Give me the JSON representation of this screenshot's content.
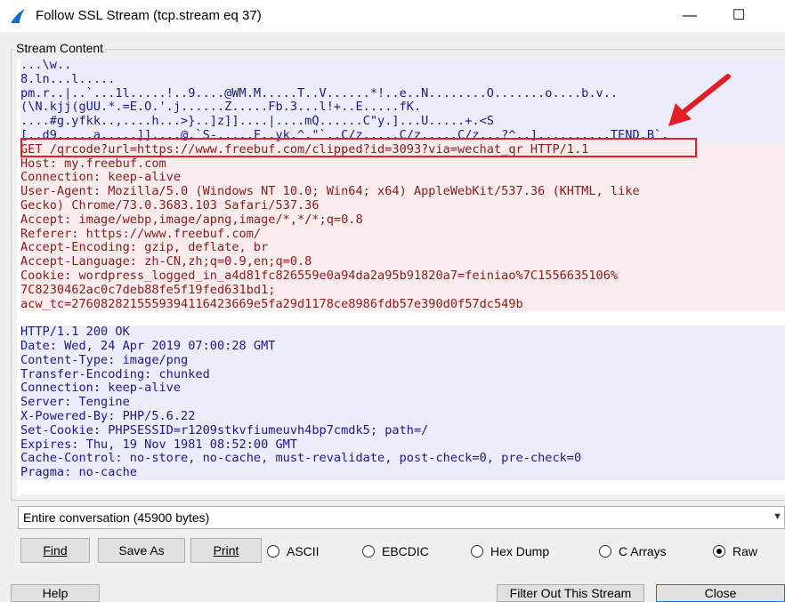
{
  "window": {
    "title": "Follow SSL Stream (tcp.stream eq 37)",
    "minimize_glyph": "—",
    "maximize_glyph": "☐"
  },
  "group": {
    "label": "Stream Content"
  },
  "stream_lines": [
    {
      "text": "...\\w..",
      "kind": "srv"
    },
    {
      "text": "8.ln...l.....",
      "kind": "srv"
    },
    {
      "text": "pm.r..|..`...1l.....!..9....@WM.M.....T..V......*!..e..N........O.......o....b.v..",
      "kind": "srv"
    },
    {
      "text": "(\\N.kjj(gUU.*.=E.O.'.j......Z.....Fb.3...l!+..E.....fK.",
      "kind": "srv"
    },
    {
      "text": "....#g.yfkk..,....h...>}..]z]]....|....mQ......C\"y.]...U.....+.<S",
      "kind": "srv"
    },
    {
      "text": "[..d9.....a.....]]....@.`S-.....F..yk.^.\"`..C/z.....C/z.....C/z...?^..]..........TEND.B`.",
      "kind": "srv"
    },
    {
      "text": "GET /qrcode?url=https://www.freebuf.com/clipped?id=3093?via=wechat_qr HTTP/1.1",
      "kind": "cli"
    },
    {
      "text": "Host: my.freebuf.com",
      "kind": "cli"
    },
    {
      "text": "Connection: keep-alive",
      "kind": "cli"
    },
    {
      "text": "User-Agent: Mozilla/5.0 (Windows NT 10.0; Win64; x64) AppleWebKit/537.36 (KHTML, like",
      "kind": "cli"
    },
    {
      "text": "Gecko) Chrome/73.0.3683.103 Safari/537.36",
      "kind": "cli"
    },
    {
      "text": "Accept: image/webp,image/apng,image/*,*/*;q=0.8",
      "kind": "cli"
    },
    {
      "text": "Referer: https://www.freebuf.com/",
      "kind": "cli"
    },
    {
      "text": "Accept-Encoding: gzip, deflate, br",
      "kind": "cli"
    },
    {
      "text": "Accept-Language: zh-CN,zh;q=0.9,en;q=0.8",
      "kind": "cli"
    },
    {
      "text": "Cookie: wordpress_logged_in_a4d81fc826559e0a94da2a95b91820a7=feiniao%7C1556635106%",
      "kind": "cli"
    },
    {
      "text": "7C8230462ac0c7deb88fe5f19fed631bd1;",
      "kind": "cli"
    },
    {
      "text": "acw_tc=2760828215559394116423669e5fa29d1178ce8986fdb57e390d0f57dc549b",
      "kind": "cli"
    },
    {
      "text": "",
      "kind": "blank"
    },
    {
      "text": "HTTP/1.1 200 OK",
      "kind": "srv"
    },
    {
      "text": "Date: Wed, 24 Apr 2019 07:00:28 GMT",
      "kind": "srv"
    },
    {
      "text": "Content-Type: image/png",
      "kind": "srv"
    },
    {
      "text": "Transfer-Encoding: chunked",
      "kind": "srv"
    },
    {
      "text": "Connection: keep-alive",
      "kind": "srv"
    },
    {
      "text": "Server: Tengine",
      "kind": "srv"
    },
    {
      "text": "X-Powered-By: PHP/5.6.22",
      "kind": "srv"
    },
    {
      "text": "Set-Cookie: PHPSESSID=r1209stkvfiumeuvh4bp7cmdk5; path=/",
      "kind": "srv"
    },
    {
      "text": "Expires: Thu, 19 Nov 1981 08:52:00 GMT",
      "kind": "srv"
    },
    {
      "text": "Cache-Control: no-store, no-cache, must-revalidate, post-check=0, pre-check=0",
      "kind": "srv"
    },
    {
      "text": "Pragma: no-cache",
      "kind": "srv"
    },
    {
      "text": "",
      "kind": "blank"
    },
    {
      "text": "...",
      "kind": "srv"
    }
  ],
  "conversation_select": {
    "value": "Entire conversation (45900 bytes)"
  },
  "buttons": {
    "find": "Find",
    "save_as": "Save As",
    "print": "Print"
  },
  "radios": [
    {
      "label": "ASCII",
      "checked": false
    },
    {
      "label": "EBCDIC",
      "checked": false
    },
    {
      "label": "Hex Dump",
      "checked": false
    },
    {
      "label": "C Arrays",
      "checked": false
    },
    {
      "label": "Raw",
      "checked": true
    }
  ],
  "bottom_buttons": {
    "help": "Help",
    "filter": "Filter Out This Stream",
    "close": "Close"
  },
  "colors": {
    "client_text": "#8b1a1a",
    "client_bg": "#fbeded",
    "server_text": "#1a1a8b",
    "server_bg": "#ececfa",
    "annotation_red": "#e31e24"
  }
}
